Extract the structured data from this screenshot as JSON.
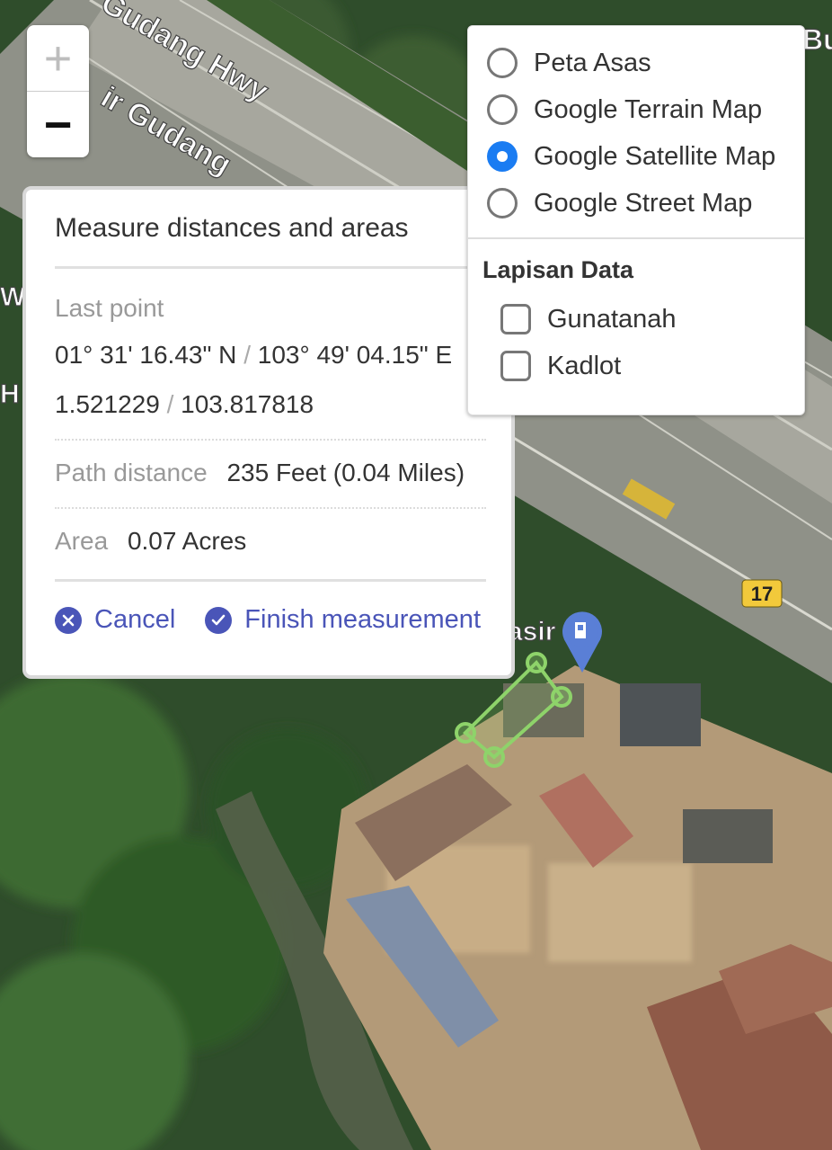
{
  "map": {
    "road_labels": [
      "Gudang Hwy",
      "ir Gudang",
      "Bu",
      "Wa",
      "H"
    ],
    "poi_label": "asir",
    "route_shield": "17",
    "measurement_polygon_color": "#8ed36a"
  },
  "zoom": {
    "in_label": "+",
    "out_label": "−"
  },
  "measure_panel": {
    "title": "Measure distances and areas",
    "last_point_label": "Last point",
    "dms": {
      "lat": "01° 31' 16.43\" N",
      "sep": "/",
      "lon": "103° 49' 04.15\" E"
    },
    "decimal": {
      "lat": "1.521229",
      "sep": "/",
      "lon": "103.817818"
    },
    "path_label": "Path distance",
    "path_value": "235 Feet (0.04 Miles)",
    "area_label": "Area",
    "area_value": "0.07 Acres",
    "cancel_label": "Cancel",
    "finish_label": "Finish measurement",
    "accent": "#4a55b8"
  },
  "layers_panel": {
    "base_layers": [
      {
        "label": "Peta Asas",
        "selected": false
      },
      {
        "label": "Google Terrain Map",
        "selected": false
      },
      {
        "label": "Google Satellite Map",
        "selected": true
      },
      {
        "label": "Google Street Map",
        "selected": false
      }
    ],
    "overlay_title": "Lapisan Data",
    "overlays": [
      {
        "label": "Gunatanah",
        "checked": false
      },
      {
        "label": "Kadlot",
        "checked": false
      }
    ],
    "selected_color": "#1a7cf2"
  }
}
